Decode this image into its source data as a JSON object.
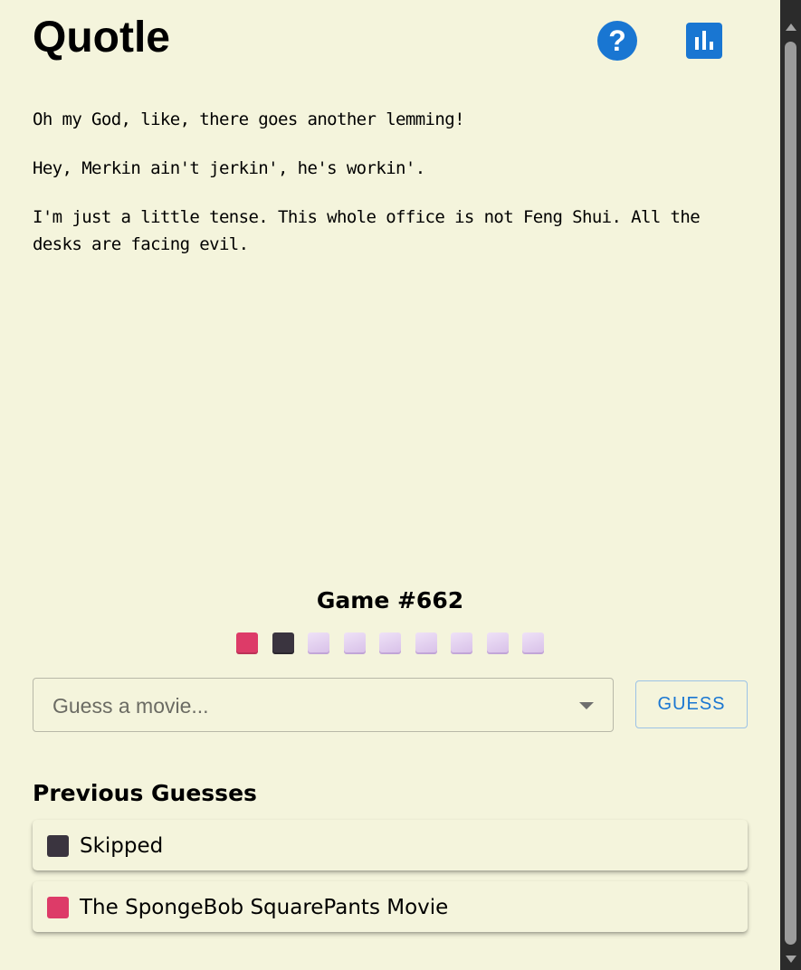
{
  "header": {
    "title": "Quotle",
    "help_icon": "question-circle-icon",
    "stats_icon": "bar-chart-icon",
    "accent_color": "#1976d2"
  },
  "quotes": [
    "Oh my God, like, there goes another lemming!",
    "Hey, Merkin ain't jerkin', he's workin'.",
    "I'm just a little tense. This whole office is not Feng Shui. All the desks are facing evil."
  ],
  "game": {
    "label": "Game #662",
    "progress": [
      "wrong",
      "skipped",
      "pending",
      "pending",
      "pending",
      "pending",
      "pending",
      "pending",
      "pending"
    ],
    "colors": {
      "wrong": "#dd3b68",
      "skipped": "#3a343f",
      "pending": "#e2cdf0"
    }
  },
  "guess": {
    "placeholder": "Guess a movie...",
    "button_label": "GUESS"
  },
  "previous": {
    "title": "Previous Guesses",
    "items": [
      {
        "status": "skipped",
        "text": "Skipped"
      },
      {
        "status": "wrong",
        "text": "The SpongeBob SquarePants Movie"
      }
    ]
  }
}
